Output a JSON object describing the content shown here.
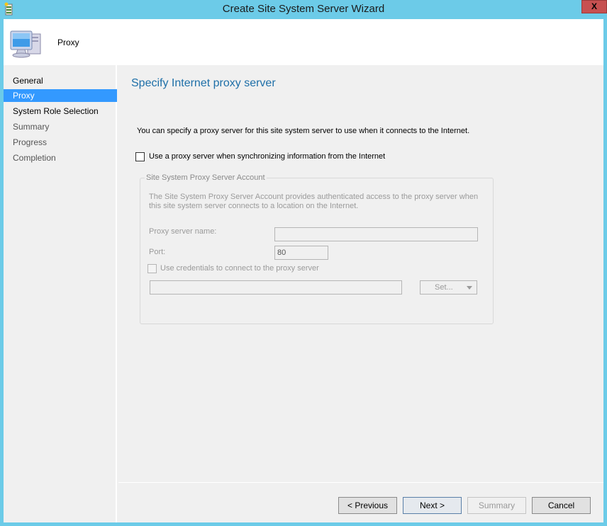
{
  "window": {
    "title": "Create Site System Server Wizard",
    "close_label": "X",
    "app_icon": "wizard-scroll-icon"
  },
  "header": {
    "title": "Proxy",
    "icon": "computer-icon"
  },
  "sidebar": {
    "items": [
      {
        "label": "General",
        "state": "completed"
      },
      {
        "label": "Proxy",
        "state": "active"
      },
      {
        "label": "System Role Selection",
        "state": "completed"
      },
      {
        "label": "Summary",
        "state": "pending"
      },
      {
        "label": "Progress",
        "state": "pending"
      },
      {
        "label": "Completion",
        "state": "pending"
      }
    ]
  },
  "main": {
    "page_title": "Specify Internet proxy server",
    "description": "You can specify a proxy server for this site system server to use when it connects to the Internet.",
    "use_proxy_checkbox": {
      "label": "Use a proxy server when synchronizing information from the Internet",
      "checked": false
    },
    "group": {
      "legend": "Site System Proxy Server Account",
      "description": "The Site System Proxy Server Account provides authenticated access to the proxy server when this site system server connects to a location on the Internet.",
      "proxy_server_name_label": "Proxy server name:",
      "proxy_server_name_value": "",
      "port_label": "Port:",
      "port_value": "80",
      "credentials_checkbox": {
        "label": "Use credentials to connect to the proxy server",
        "checked": false
      },
      "account_value": "",
      "set_button_label": "Set..."
    }
  },
  "footer": {
    "previous_label": "< Previous",
    "next_label": "Next >",
    "summary_label": "Summary",
    "cancel_label": "Cancel"
  },
  "colors": {
    "titlebar": "#6ccbe8",
    "active_nav": "#3399ff",
    "page_title": "#1e6fa8",
    "close_button": "#c75050"
  }
}
